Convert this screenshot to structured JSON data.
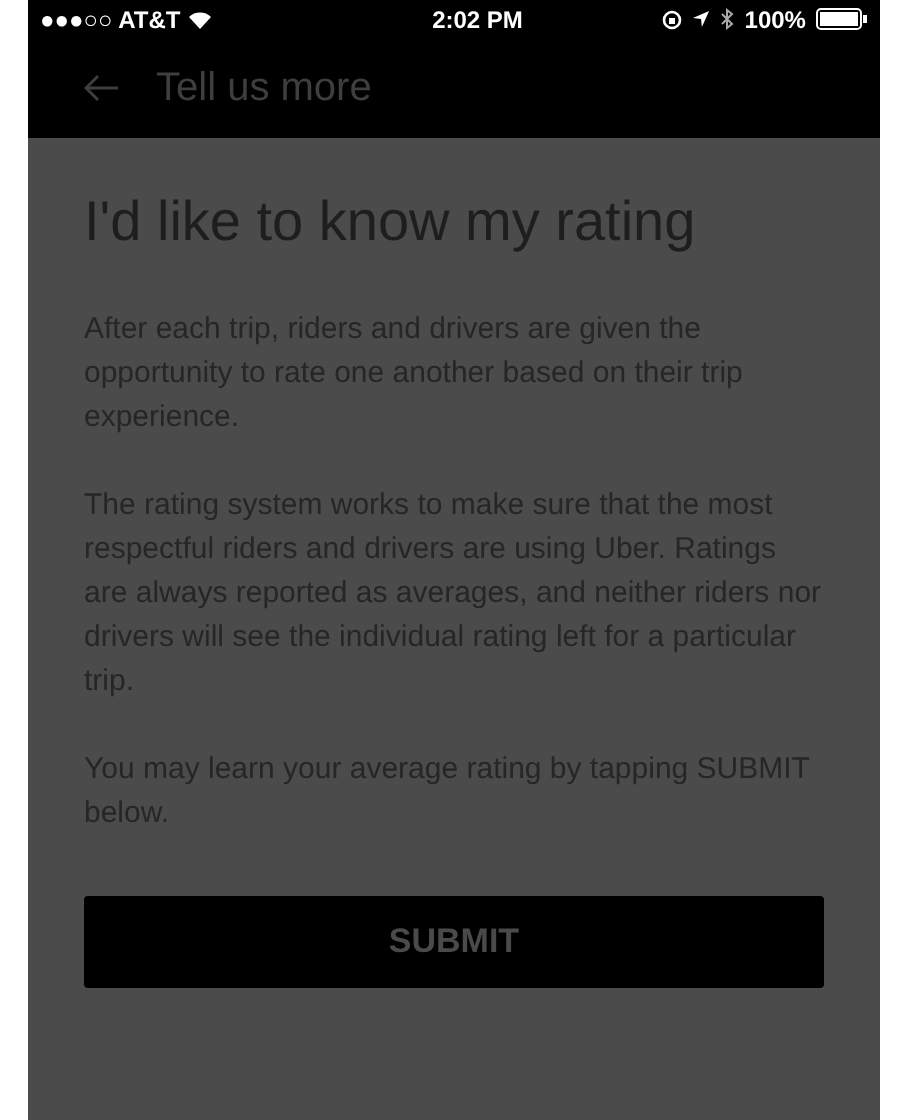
{
  "status_bar": {
    "carrier": "●●●○○ AT&T",
    "time": "2:02 PM",
    "battery": "100%"
  },
  "nav_bar": {
    "title": "Tell us more"
  },
  "heading": "I'd like to know my rating",
  "paragraphs": [
    "After each trip, riders and drivers are given the opportunity to rate one another based on their trip experience.",
    "The rating system works to make sure that the most respectful riders and drivers are using Uber. Ratings are always reported as averages, and neither riders nor drivers will see the individual rating left for a particular trip.",
    "You may learn your average rating by tapping SUBMIT below."
  ],
  "button": "SUBMIT"
}
